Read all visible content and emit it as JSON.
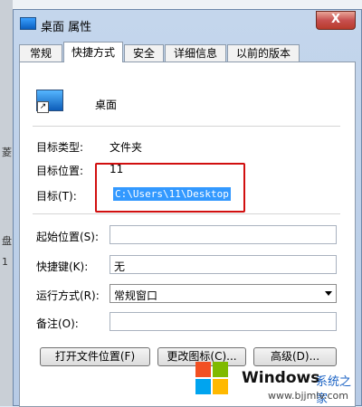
{
  "background_text": [
    "菱",
    "盘",
    "1"
  ],
  "dialog": {
    "title": "桌面 属性",
    "close_label": "X",
    "tabs": [
      "常规",
      "快捷方式",
      "安全",
      "详细信息",
      "以前的版本"
    ],
    "active_tab": "快捷方式",
    "shortcut_name": "桌面",
    "fields": {
      "target_type_label": "目标类型:",
      "target_type_value": "文件夹",
      "target_location_label": "目标位置:",
      "target_location_value": "11",
      "target_label": "目标(T):",
      "target_value": "C:\\Users\\11\\Desktop",
      "start_in_label": "起始位置(S):",
      "start_in_value": "",
      "hotkey_label": "快捷键(K):",
      "hotkey_value": "无",
      "run_label": "运行方式(R):",
      "run_value": "常规窗口",
      "comment_label": "备注(O):",
      "comment_value": ""
    },
    "buttons": {
      "open_location": "打开文件位置(F)",
      "change_icon": "更改图标(C)...",
      "advanced": "高级(D)..."
    }
  },
  "watermark": {
    "brand": "Windows",
    "cn": "系统之家",
    "url": "www.bjjmlv.com"
  },
  "colors": {
    "highlight": "#3399ff",
    "annotation_red": "#d10f0f",
    "titlebar": "#c4d6ec"
  }
}
